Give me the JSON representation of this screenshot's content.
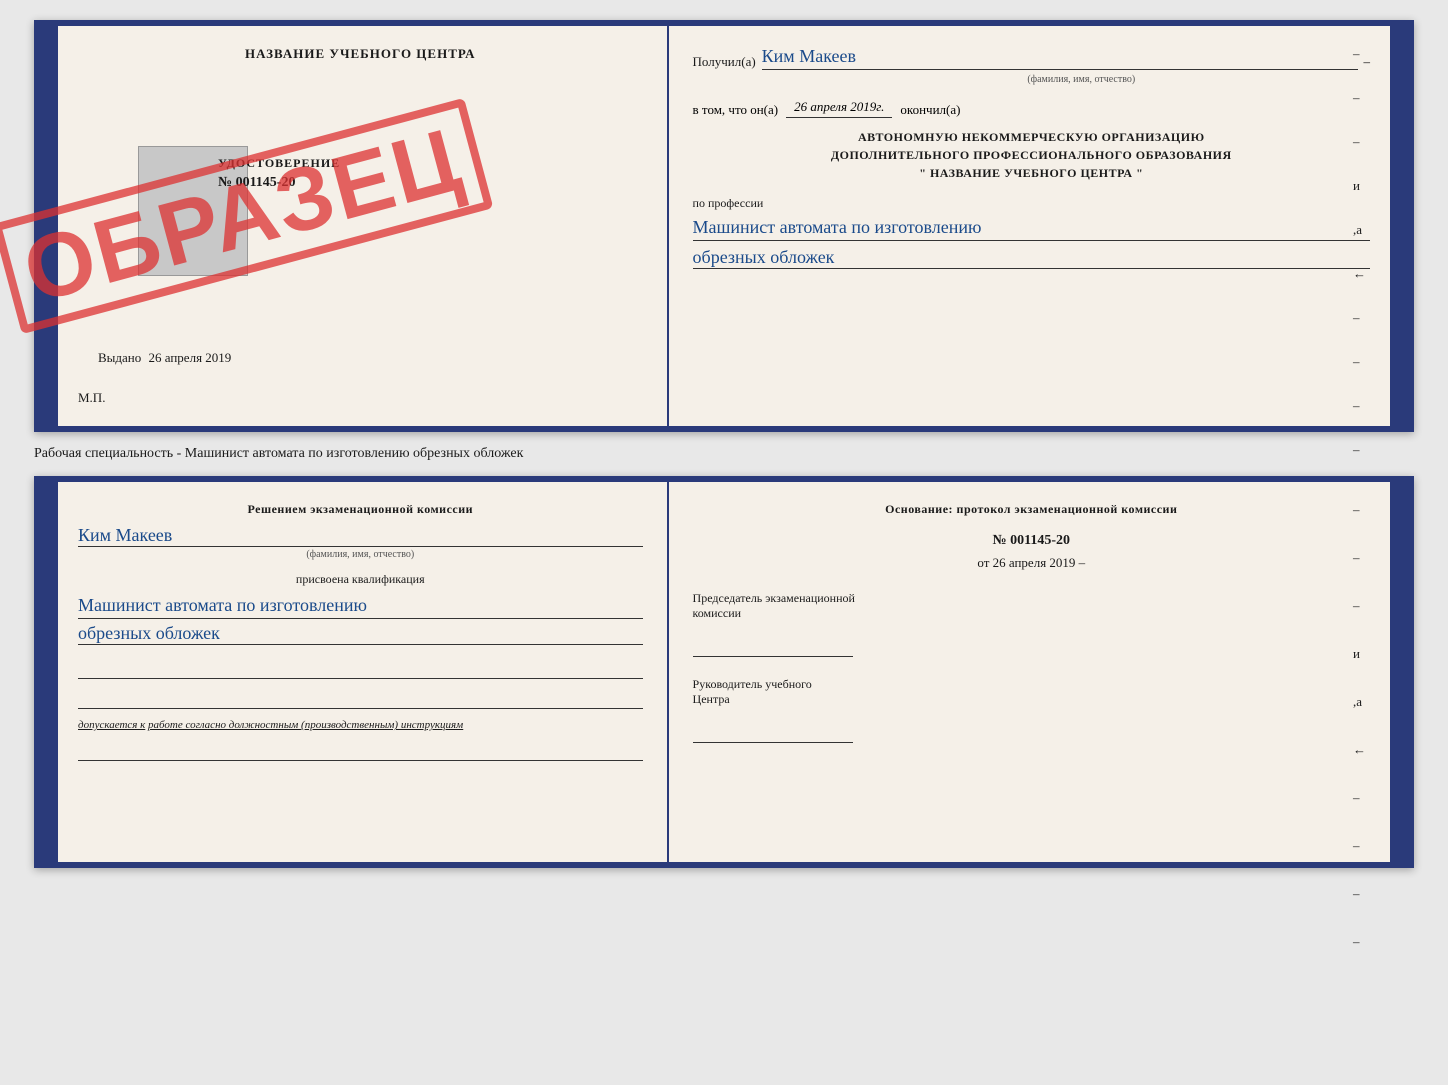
{
  "top_book": {
    "left": {
      "header": "НАЗВАНИЕ УЧЕБНОГО ЦЕНТРА",
      "udostoverenie_title": "УДОСТОВЕРЕНИЕ",
      "udostoverenie_number": "№ 001145-20",
      "vudano_label": "Выдано",
      "vudano_date": "26 апреля 2019",
      "mp_label": "М.П.",
      "stamp_text": "ОБРАЗЕЦ"
    },
    "right": {
      "poluchil_label": "Получил(а)",
      "poluchil_name": "Ким Макеев",
      "poluchil_dash": "–",
      "fio_subtitle": "(фамилия, имя, отчество)",
      "vtom_label": "в том, что он(а)",
      "vtom_date": "26 апреля 2019г.",
      "okonchil_label": "окончил(а)",
      "autonomnaya_line1": "АВТОНОМНУЮ НЕКОММЕРЧЕСКУЮ ОРГАНИЗАЦИЮ",
      "autonomnaya_line2": "ДОПОЛНИТЕЛЬНОГО ПРОФЕССИОНАЛЬНОГО ОБРАЗОВАНИЯ",
      "autonomnaya_line3": "\"    НАЗВАНИЕ УЧЕБНОГО ЦЕНТРА    \"",
      "po_professii": "по профессии",
      "profession_line1": "Машинист автомата по изготовлению",
      "profession_line2": "обрезных обложек",
      "dash1": "–",
      "dash2": "–",
      "dash3": "–",
      "dash4": "и",
      "dash5": ",а",
      "dash6": "←",
      "dash7": "–",
      "dash8": "–",
      "dash9": "–",
      "dash10": "–"
    }
  },
  "specialty_label": "Рабочая специальность - Машинист автомата по изготовлению обрезных обложек",
  "bottom_book": {
    "left": {
      "resheniyem": "Решением экзаменационной комиссии",
      "name": "Ким Макеев",
      "fio_subtitle": "(фамилия, имя, отчество)",
      "prisvoena": "присвоена квалификация",
      "kval_line1": "Машинист автомата по изготовлению",
      "kval_line2": "обрезных обложек",
      "dopuskaetsya_label": "допускается к",
      "dopuskaetsya_text": "работе согласно должностным (производственным) инструкциям"
    },
    "right": {
      "osnovanie": "Основание: протокол экзаменационной комиссии",
      "protocol_number": "№ 001145-20",
      "ot_label": "от",
      "ot_date": "26 апреля 2019",
      "predsedatel_line1": "Председатель экзаменационной",
      "predsedatel_line2": "комиссии",
      "rukovoditel_line1": "Руководитель учебного",
      "rukovoditel_line2": "Центра",
      "dash1": "–",
      "dash2": "–",
      "dash3": "–",
      "dash4": "и",
      "dash5": ",а",
      "dash6": "←",
      "dash7": "–",
      "dash8": "–",
      "dash9": "–",
      "dash10": "–"
    }
  }
}
